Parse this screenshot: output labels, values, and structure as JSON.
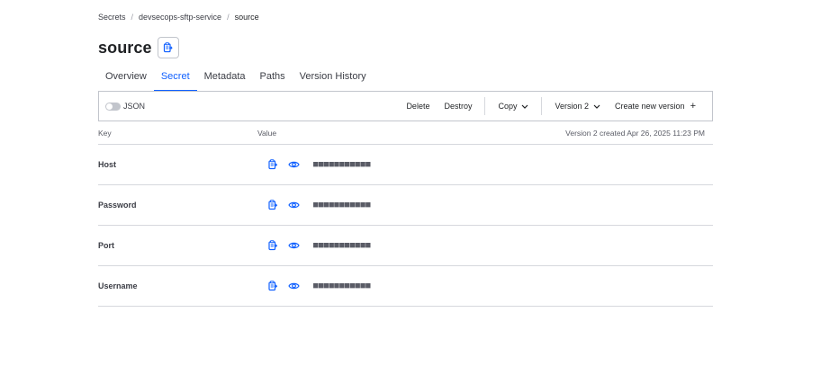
{
  "breadcrumb": {
    "items": [
      "Secrets",
      "devsecops-sftp-service"
    ],
    "current": "source",
    "separator": "/"
  },
  "page": {
    "title": "source",
    "copy_icon": "copy-icon"
  },
  "tabs": [
    {
      "label": "Overview",
      "active": false
    },
    {
      "label": "Secret",
      "active": true
    },
    {
      "label": "Metadata",
      "active": false
    },
    {
      "label": "Paths",
      "active": false
    },
    {
      "label": "Version History",
      "active": false
    }
  ],
  "toolbar": {
    "json_toggle_label": "JSON",
    "json_toggle_on": false,
    "delete_label": "Delete",
    "destroy_label": "Destroy",
    "copy_label": "Copy",
    "version_label": "Version 2",
    "create_label": "Create new version",
    "create_icon": "+"
  },
  "table": {
    "key_header": "Key",
    "value_header": "Value",
    "version_meta": "Version 2 created Apr 26, 2025 11:23 PM",
    "masked_value": "■■■■■■■■■■■",
    "rows": [
      {
        "key": "Host"
      },
      {
        "key": "Password"
      },
      {
        "key": "Port"
      },
      {
        "key": "Username"
      }
    ]
  },
  "colors": {
    "accent": "#1060ff",
    "text": "#1f2124",
    "muted": "#5a5c66",
    "border": "#d6d8dd"
  }
}
